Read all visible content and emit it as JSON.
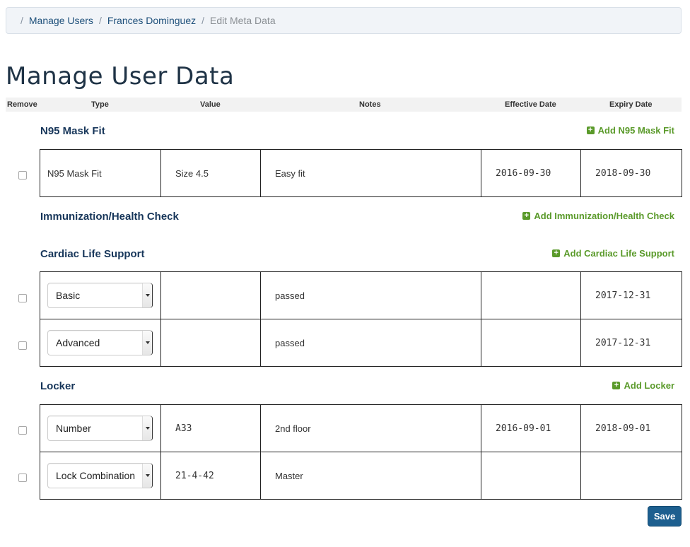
{
  "breadcrumb": {
    "items": [
      "Manage Users",
      "Frances Dominguez"
    ],
    "current": "Edit Meta Data"
  },
  "page": {
    "title": "Manage User Data"
  },
  "columns": {
    "remove": "Remove",
    "type": "Type",
    "value": "Value",
    "notes": "Notes",
    "effective": "Effective Date",
    "expiry": "Expiry Date"
  },
  "sections": {
    "n95": {
      "title": "N95 Mask Fit",
      "add_label": "Add N95 Mask Fit",
      "rows": [
        {
          "type": "N95 Mask Fit",
          "value": "Size 4.5",
          "notes": "Easy fit",
          "effective": "2016-09-30",
          "expiry": "2018-09-30"
        }
      ]
    },
    "immunization": {
      "title": "Immunization/Health Check",
      "add_label": "Add Immunization/Health Check"
    },
    "cardiac": {
      "title": "Cardiac Life Support",
      "add_label": "Add Cardiac Life Support",
      "rows": [
        {
          "type": "Basic",
          "value": "",
          "notes": "passed",
          "effective": "",
          "expiry": "2017-12-31"
        },
        {
          "type": "Advanced",
          "value": "",
          "notes": "passed",
          "effective": "",
          "expiry": "2017-12-31"
        }
      ]
    },
    "locker": {
      "title": "Locker",
      "add_label": "Add Locker",
      "rows": [
        {
          "type": "Number",
          "value": "A33",
          "notes": "2nd floor",
          "effective": "2016-09-01",
          "expiry": "2018-09-01"
        },
        {
          "type": "Lock Combination",
          "value": "21-4-42",
          "notes": "Master",
          "effective": "",
          "expiry": ""
        }
      ]
    }
  },
  "actions": {
    "save_label": "Save"
  },
  "colors": {
    "link": "#1d4f7a",
    "section_title": "#17365a",
    "add_green": "#5a9a2a",
    "save_button": "#1d5f8f"
  }
}
